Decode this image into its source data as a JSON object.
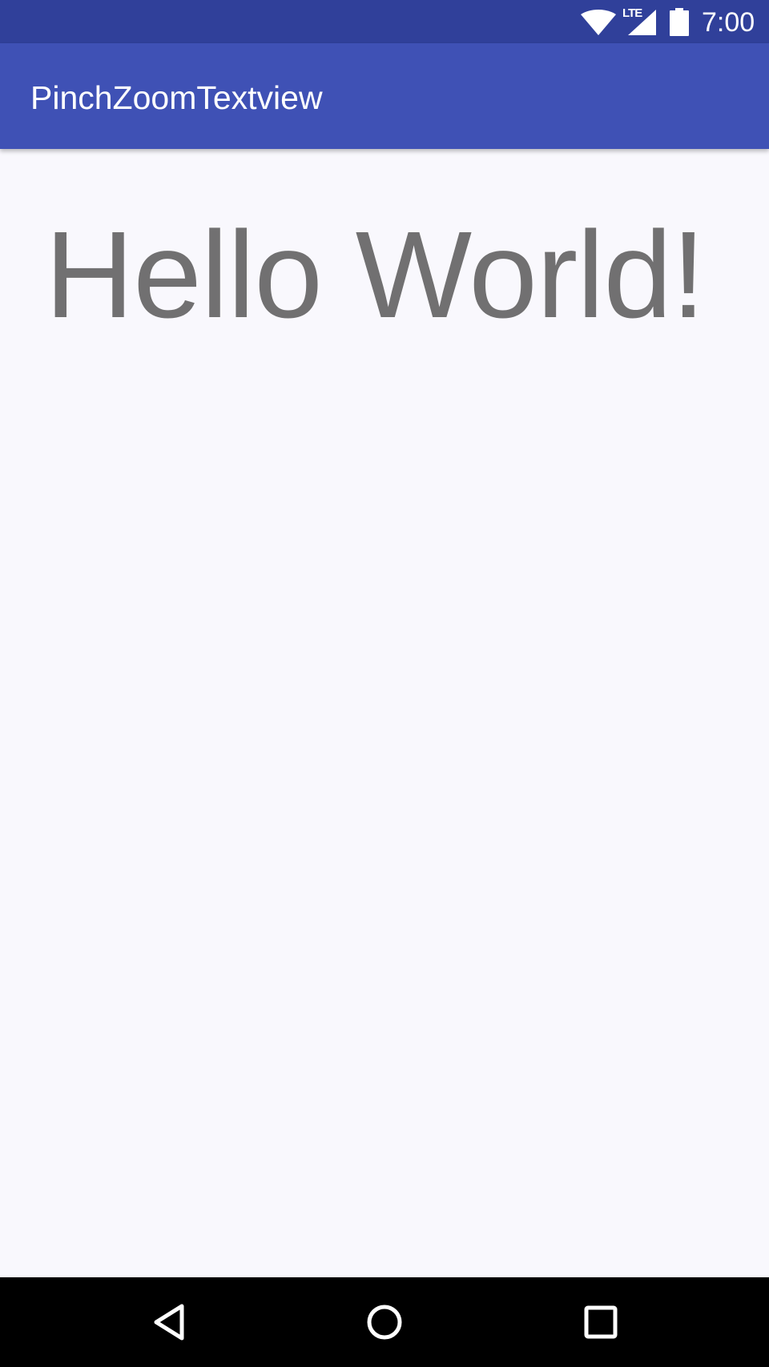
{
  "status_bar": {
    "network_label": "LTE",
    "time": "7:00",
    "icons": [
      "wifi-icon",
      "cell-signal-icon",
      "battery-icon"
    ]
  },
  "app_bar": {
    "title": "PinchZoomTextview",
    "color": "#3f51b5",
    "status_color": "#30409a"
  },
  "content": {
    "text": "Hello World!",
    "text_color": "#717071"
  },
  "nav_bar": {
    "icons": [
      "back-icon",
      "home-icon",
      "recents-icon"
    ]
  }
}
